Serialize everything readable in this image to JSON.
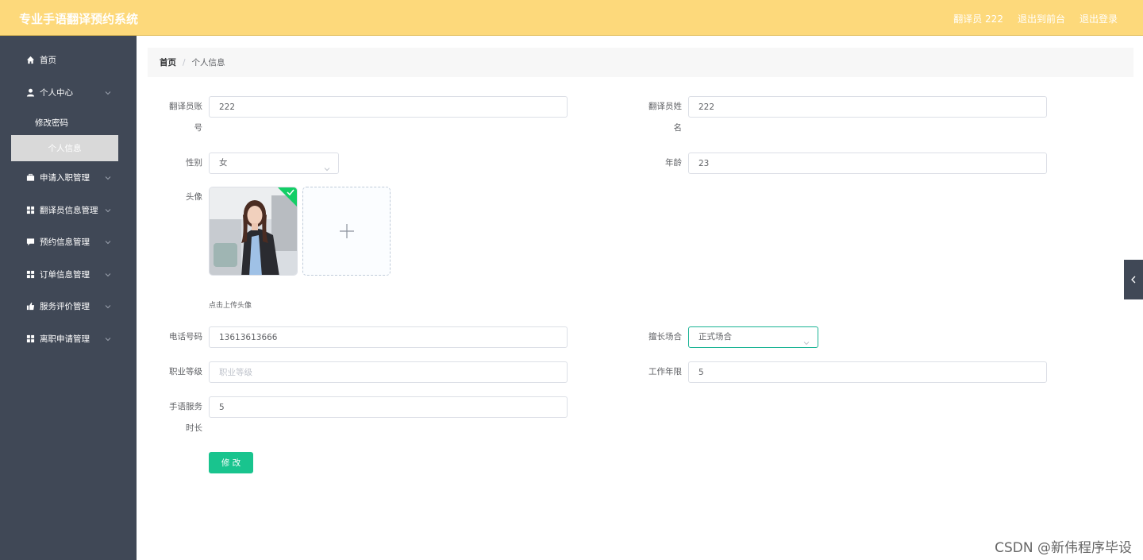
{
  "header": {
    "app_title": "专业手语翻译预约系统",
    "user_label": "翻译员 222",
    "front_link": "退出到前台",
    "logout_link": "退出登录"
  },
  "sidebar": {
    "home": "首页",
    "personal_center": "个人中心",
    "change_password": "修改密码",
    "personal_info": "个人信息",
    "items": [
      {
        "label": "申请入职管理",
        "icon": "briefcase-icon"
      },
      {
        "label": "翻译员信息管理",
        "icon": "grid-icon"
      },
      {
        "label": "预约信息管理",
        "icon": "chat-icon"
      },
      {
        "label": "订单信息管理",
        "icon": "grid-icon"
      },
      {
        "label": "服务评价管理",
        "icon": "thumb-icon"
      },
      {
        "label": "离职申请管理",
        "icon": "grid-icon"
      }
    ]
  },
  "breadcrumb": {
    "home": "首页",
    "separator": "/",
    "current": "个人信息"
  },
  "form": {
    "account_label_1": "翻译员账",
    "account_label_2": "号",
    "account_value": "222",
    "name_label_1": "翻译员姓",
    "name_label_2": "名",
    "name_value": "222",
    "gender_label": "性别",
    "gender_value": "女",
    "age_label": "年龄",
    "age_value": "23",
    "avatar_label": "头像",
    "avatar_tip": "点击上传头像",
    "phone_label": "电话号码",
    "phone_value": "13613613666",
    "specialty_label": "擅长场合",
    "specialty_value": "正式场合",
    "level_label": "职业等级",
    "level_placeholder": "职业等级",
    "years_label": "工作年限",
    "years_value": "5",
    "service_label_1": "手语服务",
    "service_label_2": "时长",
    "service_value": "5",
    "submit_label": "修 改"
  },
  "watermark": "CSDN @新伟程序毕设",
  "colors": {
    "header_bg": "#fdd97b",
    "sidebar_bg": "#404856",
    "primary": "#19c48e"
  }
}
